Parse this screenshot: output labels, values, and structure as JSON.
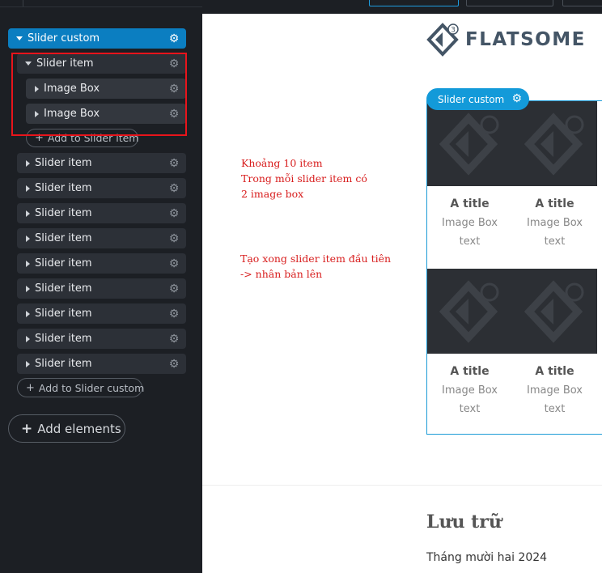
{
  "tree": {
    "root": {
      "label": "Slider custom"
    },
    "expanded_item": {
      "label": "Slider item",
      "children": [
        {
          "label": "Image Box"
        },
        {
          "label": "Image Box"
        }
      ],
      "add_label": "Add to Slider item"
    },
    "collapsed_items": [
      {
        "label": "Slider item"
      },
      {
        "label": "Slider item"
      },
      {
        "label": "Slider item"
      },
      {
        "label": "Slider item"
      },
      {
        "label": "Slider item"
      },
      {
        "label": "Slider item"
      },
      {
        "label": "Slider item"
      },
      {
        "label": "Slider item"
      },
      {
        "label": "Slider item"
      }
    ],
    "add_root_label": "Add to Slider custom",
    "add_elements_label": "Add elements"
  },
  "icons": {
    "gear": "gear-icon",
    "expand": "triangle-icon",
    "plus": "plus-icon"
  },
  "annotation": {
    "note1": [
      "Khoảng 10 item",
      "Trong mỗi slider item có",
      "2 image box"
    ],
    "note2": [
      "Tạo xong slider item đầu tiên",
      "-> nhân bản lên"
    ],
    "color": "#d81e1e"
  },
  "preview": {
    "logo_text": "FLATSOME",
    "slider_tag": "Slider custom",
    "boxes": [
      {
        "title": "A title",
        "text": "Image Box text"
      },
      {
        "title": "A title",
        "text": "Image Box text"
      },
      {
        "title": "A title",
        "text": "Image Box text"
      },
      {
        "title": "A title",
        "text": "Image Box text"
      }
    ],
    "archive_title": "Lưu trữ",
    "archive_link": "Tháng mười hai 2024"
  },
  "colors": {
    "accent": "#0b7ec1",
    "slider_border": "#1c9bd6",
    "sidebar_bg": "#1c1f24",
    "highlight": "#e8141b"
  }
}
